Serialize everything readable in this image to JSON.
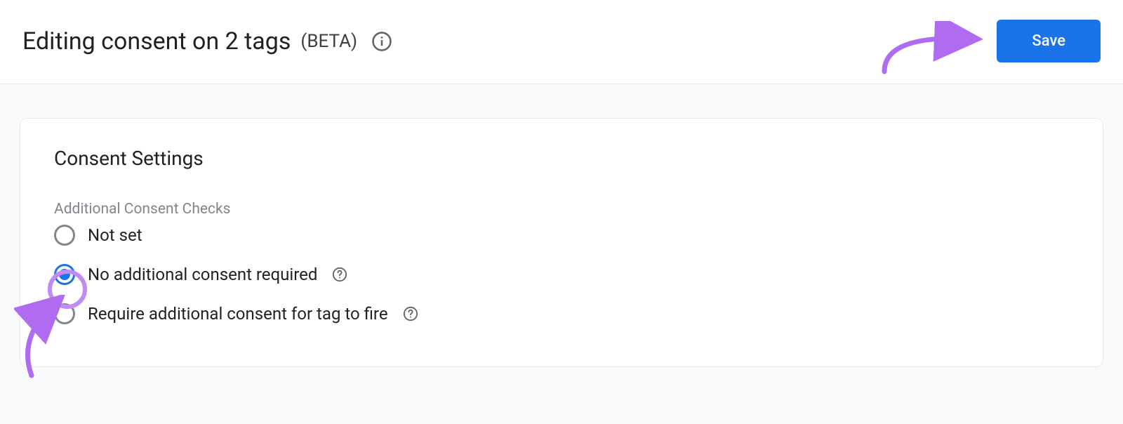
{
  "header": {
    "title": "Editing consent on 2 tags",
    "beta": "(BETA)",
    "save_label": "Save"
  },
  "card": {
    "title": "Consent Settings",
    "section_label": "Additional Consent Checks",
    "options": [
      {
        "label": "Not set",
        "help": false,
        "selected": false
      },
      {
        "label": "No additional consent required",
        "help": true,
        "selected": true
      },
      {
        "label": "Require additional consent for tag to fire",
        "help": true,
        "selected": false
      }
    ]
  },
  "colors": {
    "accent": "#1a73e8",
    "annotation": "#b06cf0"
  }
}
